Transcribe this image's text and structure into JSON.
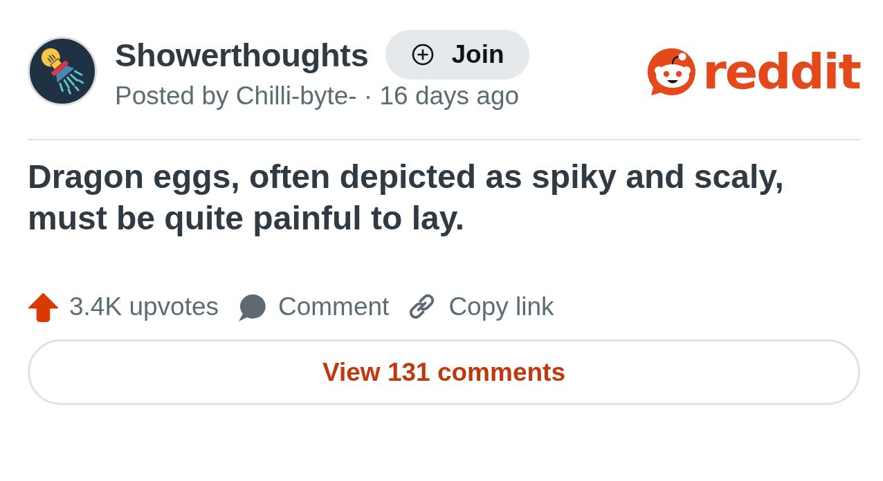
{
  "community": {
    "name": "Showerthoughts",
    "join_button": {
      "label": "Join"
    },
    "byline": "Posted by Chilli-byte- · 16 days ago"
  },
  "brand": {
    "wordmark": "reddit"
  },
  "post": {
    "title": "Dragon eggs, often depicted as spiky and scaly, must be quite painful to lay."
  },
  "actions": [
    {
      "kind": "upvote",
      "label": "3.4K upvotes"
    },
    {
      "kind": "comment",
      "label": "Comment"
    },
    {
      "kind": "copy_link",
      "label": "Copy link"
    }
  ],
  "view_comments": {
    "label": "View 131 comments"
  }
}
